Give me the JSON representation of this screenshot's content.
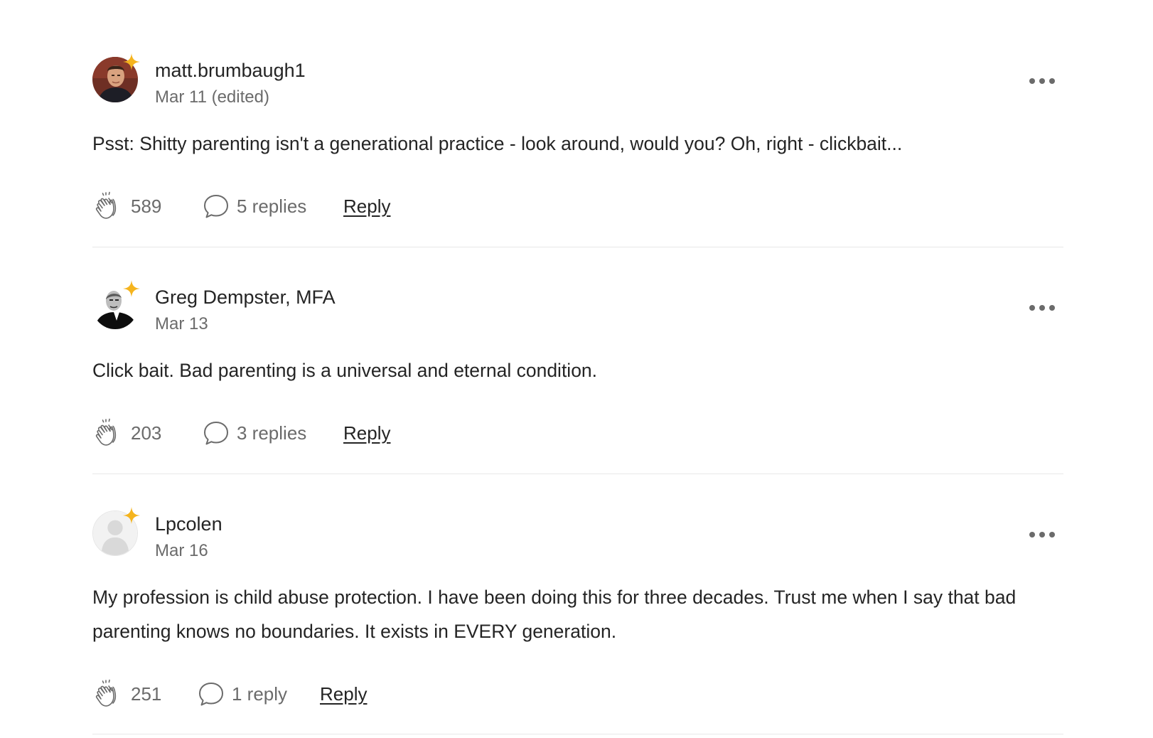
{
  "colors": {
    "text": "#242424",
    "muted": "#6b6b6b",
    "star": "#f5b41e",
    "divider": "#e8e8e8"
  },
  "icons": {
    "clap": "clap-icon",
    "replies": "speech-bubble-icon",
    "more": "more-horizontal-icon",
    "member_badge": "star-icon"
  },
  "comments": [
    {
      "author": "matt.brumbaugh1",
      "date": "Mar 11 (edited)",
      "body": "Psst: Shitty parenting isn't a generational practice - look around, would you? Oh, right - clickbait...",
      "claps": "589",
      "replies": "5 replies",
      "reply_label": "Reply"
    },
    {
      "author": "Greg Dempster, MFA",
      "date": "Mar 13",
      "body": "Click bait. Bad parenting is a universal and eternal condition.",
      "claps": "203",
      "replies": "3 replies",
      "reply_label": "Reply"
    },
    {
      "author": "Lpcolen",
      "date": "Mar 16",
      "body": "My profession is child abuse protection. I have been doing this for three decades. Trust me when I say that bad parenting knows no boundaries. It exists in EVERY generation.",
      "claps": "251",
      "replies": "1 reply",
      "reply_label": "Reply"
    }
  ]
}
